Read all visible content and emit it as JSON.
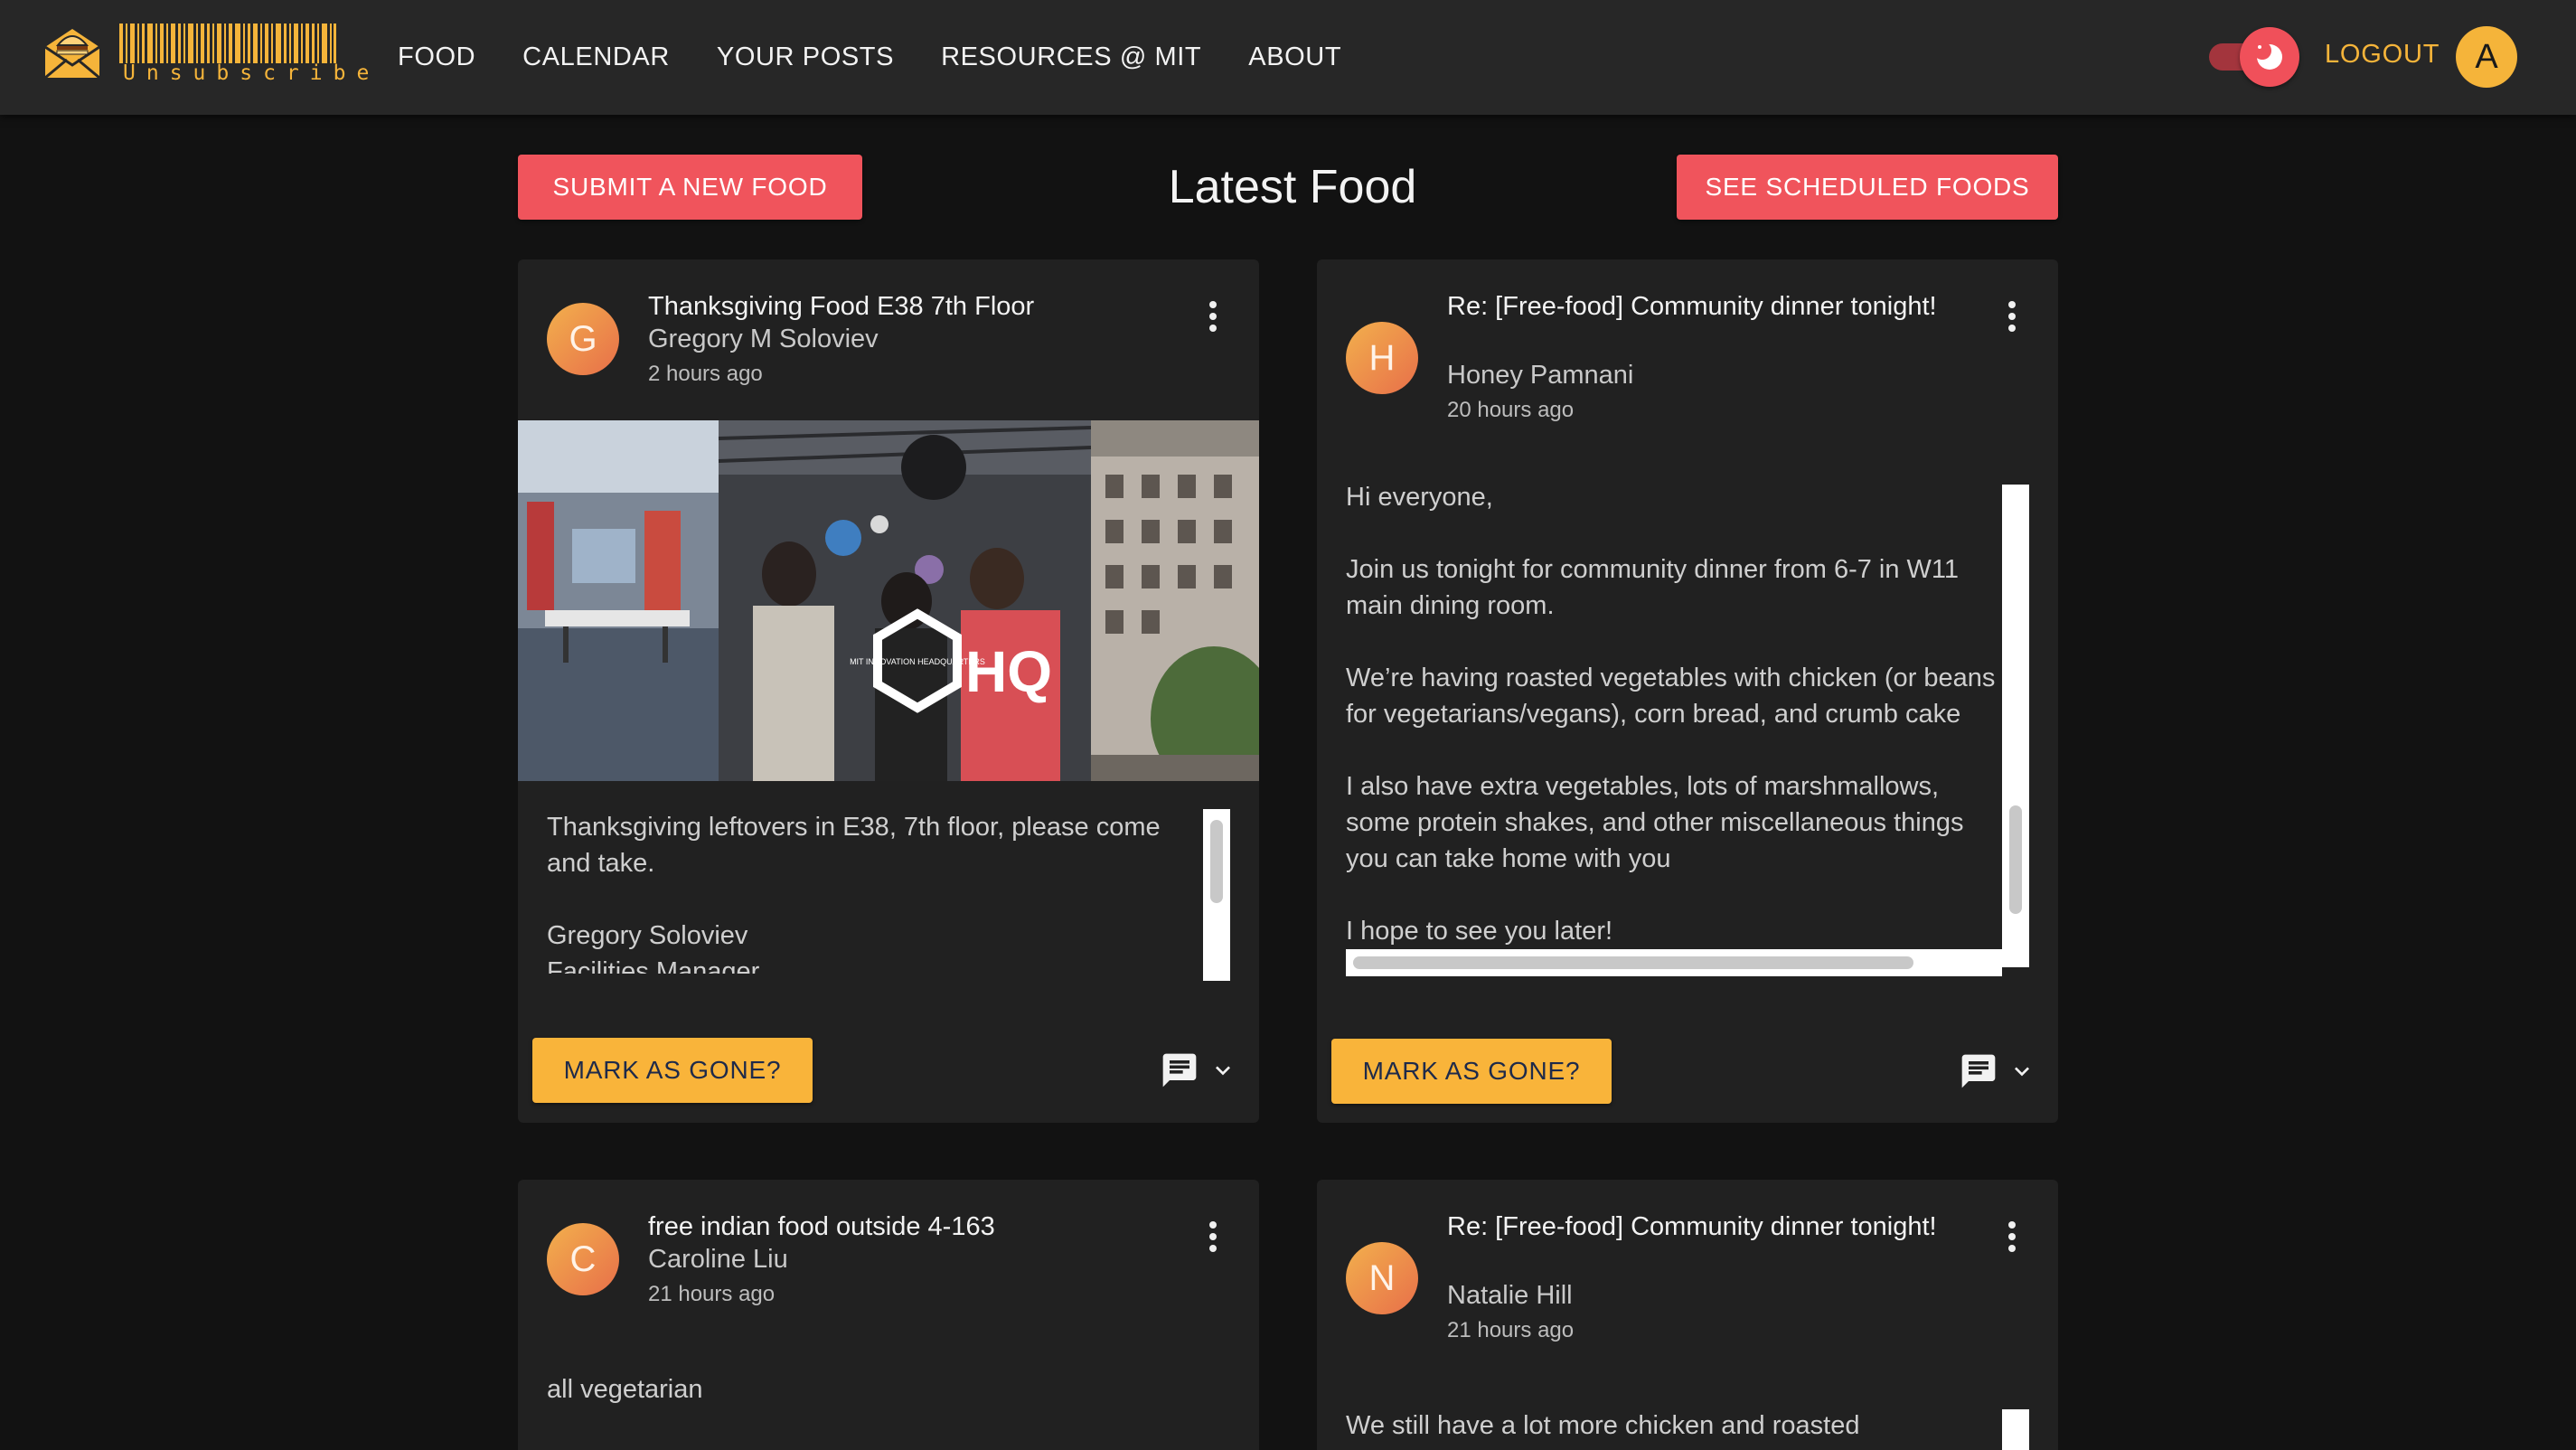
{
  "app": {
    "logo_text": "Unsubscribe"
  },
  "nav": {
    "items": [
      {
        "label": "FOOD"
      },
      {
        "label": "CALENDAR"
      },
      {
        "label": "YOUR POSTS"
      },
      {
        "label": "RESOURCES @ MIT"
      },
      {
        "label": "ABOUT"
      }
    ],
    "logout_label": "LOGOUT",
    "user_initial": "A",
    "dark_mode_on": true
  },
  "header": {
    "submit_label": "SUBMIT A NEW FOOD",
    "title": "Latest Food",
    "scheduled_label": "SEE SCHEDULED FOODS"
  },
  "posts": [
    {
      "initial": "G",
      "title": "Thanksgiving Food E38 7th Floor",
      "author": "Gregory M Soloviev",
      "time": "2 hours ago",
      "has_image": true,
      "image_overlay_text": "HQ",
      "image_badge_text": "MIT INNOVATION HEADQUARTERS",
      "body": "Thanksgiving leftovers in E38, 7th floor, please come and take.\n\nGregory Soloviev\nFacilities Manager",
      "button_label": "MARK AS GONE?"
    },
    {
      "initial": "H",
      "title": "Re: [Free-food] Community dinner tonight!",
      "author": "Honey Pamnani",
      "time": "20 hours ago",
      "has_image": false,
      "body": "Hi everyone,\n\nJoin us tonight for community dinner from 6-7 in W11 main dining room.\n\nWe’re having roasted vegetables with chicken (or beans for vegetarians/vegans), corn bread, and crumb cake\n\nI also have extra vegetables, lots of marshmallows, some protein shakes, and other miscellaneous things you can take home with you\n\nI hope to see you later!",
      "button_label": "MARK AS GONE?"
    },
    {
      "initial": "C",
      "title": "free indian food outside 4-163",
      "author": "Caroline Liu",
      "time": "21 hours ago",
      "has_image": false,
      "body": "all vegetarian"
    },
    {
      "initial": "N",
      "title": "Re: [Free-food] Community dinner tonight!",
      "author": "Natalie Hill",
      "time": "21 hours ago",
      "has_image": false,
      "body": "We still have a lot more chicken and roasted"
    }
  ],
  "colors": {
    "accent_red": "#f0545c",
    "accent_yellow": "#f9b43a",
    "background": "#121212",
    "card": "#212121",
    "topbar": "#272727"
  },
  "icons": {
    "logo": "envelope-burger-icon",
    "more": "more-vert-icon",
    "comments": "comment-icon",
    "expand": "chevron-down-icon",
    "dark_mode": "moon-icon"
  }
}
